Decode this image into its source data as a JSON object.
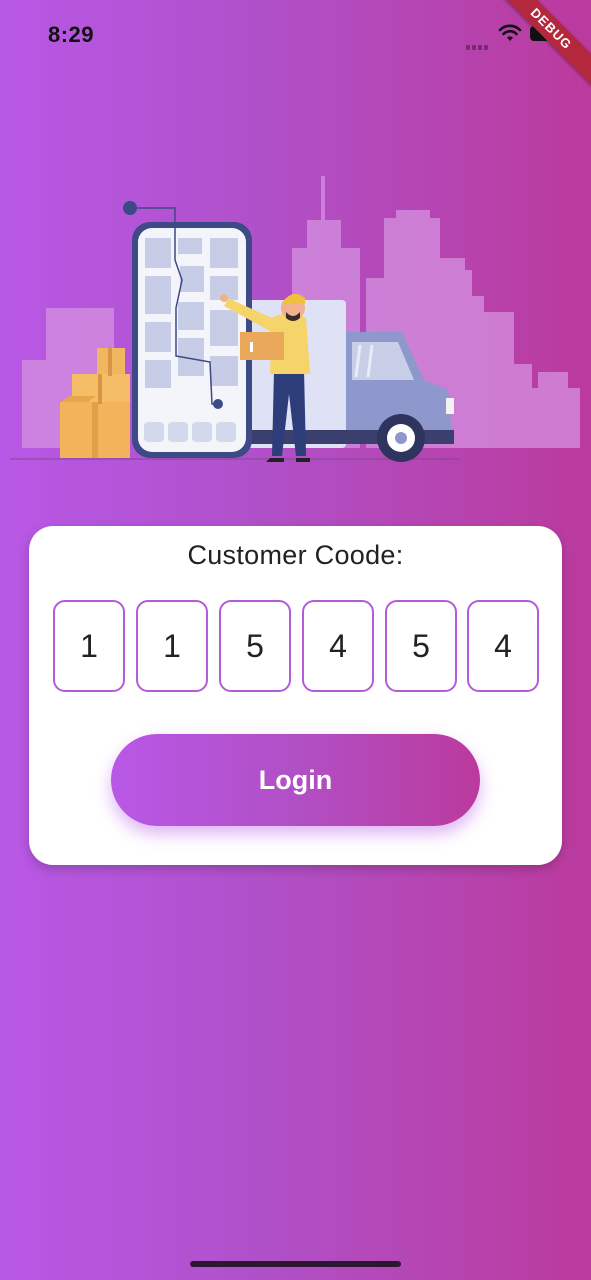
{
  "status_bar": {
    "time": "8:29",
    "icons": [
      "cellular-signal-icon",
      "wifi-icon",
      "battery-icon"
    ]
  },
  "debug_banner": "DEBUG",
  "illustration": {
    "icon": "delivery-illustration"
  },
  "login_card": {
    "title": "Customer Coode:",
    "code_digits": [
      "1",
      "1",
      "5",
      "4",
      "5",
      "4"
    ],
    "login_label": "Login"
  },
  "colors": {
    "gradient_start": "#b858e6",
    "gradient_end": "#bb3a9d",
    "box_border": "#b45bd8"
  }
}
